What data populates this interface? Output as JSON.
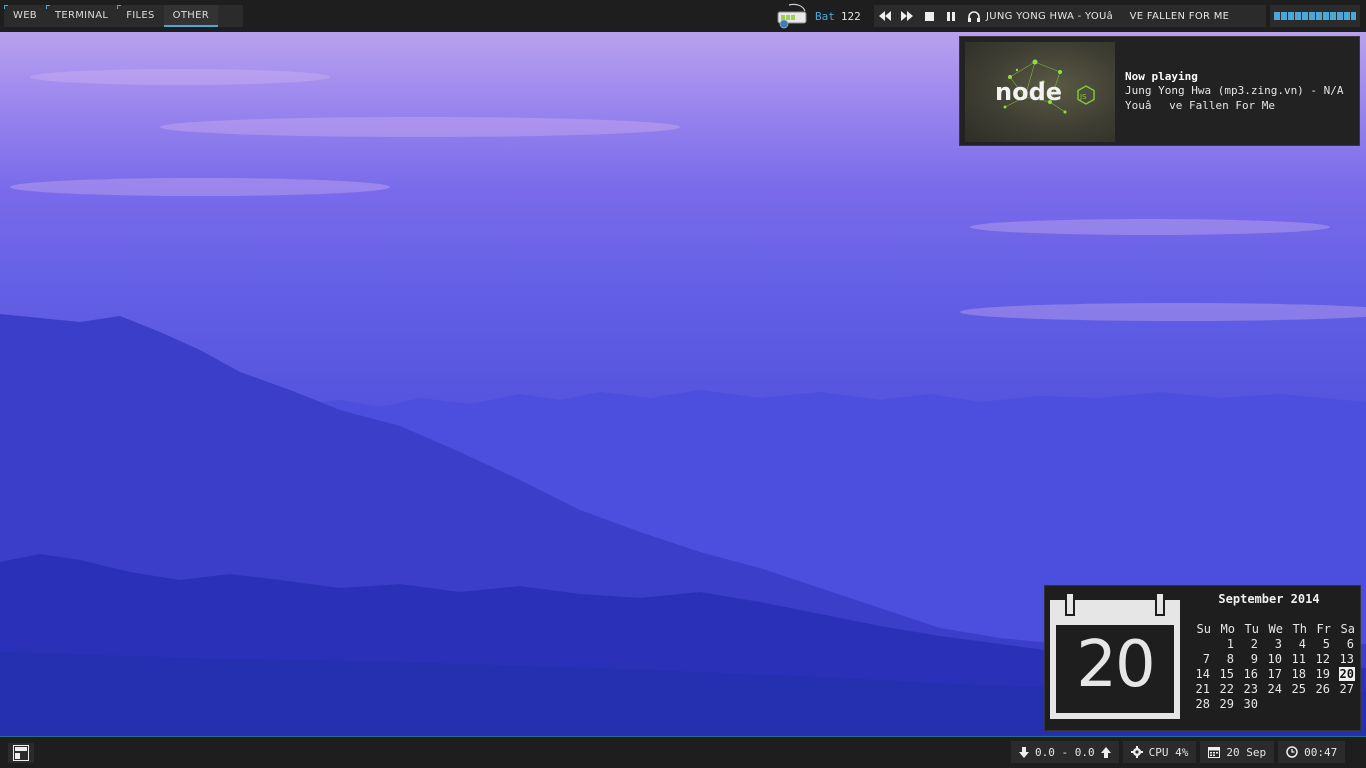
{
  "topbar": {
    "tags": [
      {
        "label": "WEB",
        "active": false
      },
      {
        "label": "TERMINAL",
        "active": false
      },
      {
        "label": "FILES",
        "active": false
      },
      {
        "label": "OTHER",
        "active": true
      }
    ],
    "battery": {
      "label": "Bat",
      "value": "122",
      "icon": "battery-plug-icon"
    },
    "player": {
      "controls": [
        "rewind-icon",
        "fast-forward-icon",
        "stop-icon",
        "pause-icon"
      ],
      "track": "JUNG YONG HWA - YOUâVE FALLEN FOR ME",
      "volume_level": 1.0
    }
  },
  "notification": {
    "title": "Now playing",
    "artist_line": "Jung Yong Hwa (mp3.zing.vn) - N/A",
    "song_line": "Youâve Fallen For Me",
    "cover_logo_text": "node JS"
  },
  "calendar": {
    "big_day": "20",
    "month_title": "September 2014",
    "weekdays": [
      "Su",
      "Mo",
      "Tu",
      "We",
      "Th",
      "Fr",
      "Sa"
    ],
    "weeks": [
      [
        "",
        "1",
        "2",
        "3",
        "4",
        "5",
        "6"
      ],
      [
        "7",
        "8",
        "9",
        "10",
        "11",
        "12",
        "13"
      ],
      [
        "14",
        "15",
        "16",
        "17",
        "18",
        "19",
        "20"
      ],
      [
        "21",
        "22",
        "23",
        "24",
        "25",
        "26",
        "27"
      ],
      [
        "28",
        "29",
        "30",
        "",
        "",
        "",
        ""
      ]
    ],
    "today": "20"
  },
  "bottombar": {
    "launcher_icon": "layout-icon",
    "net": "0.0 - 0.0",
    "cpu": "CPU 4%",
    "date": "20 Sep",
    "time": "00:47"
  },
  "colors": {
    "accent": "#4aa8d8",
    "bar": "#1e1e1e",
    "panel": "#2b2b2b"
  }
}
